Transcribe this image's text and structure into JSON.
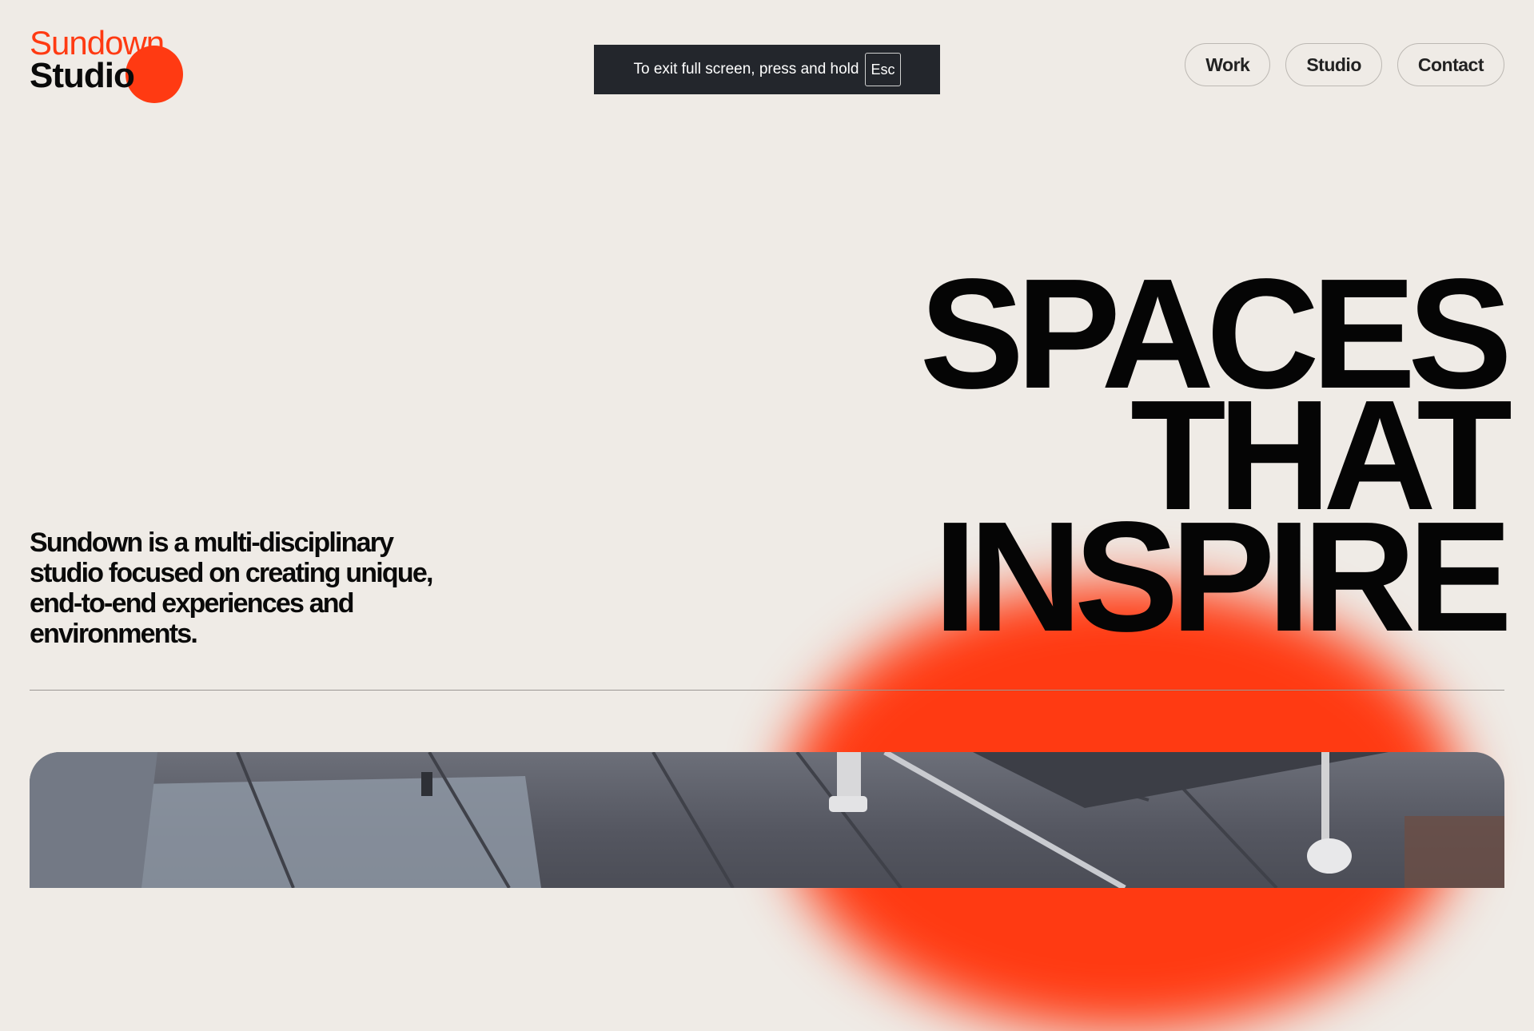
{
  "logo": {
    "line1": "Sundown",
    "line2": "Studio",
    "accent": "#ff3a12"
  },
  "fullscreen_notice": {
    "text": "To exit full screen, press and hold",
    "key": "Esc"
  },
  "nav": {
    "items": [
      {
        "label": "Work"
      },
      {
        "label": "Studio"
      },
      {
        "label": "Contact"
      }
    ]
  },
  "hero": {
    "headline": [
      "SPACES",
      "THAT",
      "INSPIRE"
    ],
    "intro": "Sundown is a multi-disciplinary studio focused on creating unique, end-to-end experiences and environments."
  },
  "colors": {
    "background": "#efebe6",
    "accent": "#ff3a12",
    "text": "#0a0a0a"
  }
}
